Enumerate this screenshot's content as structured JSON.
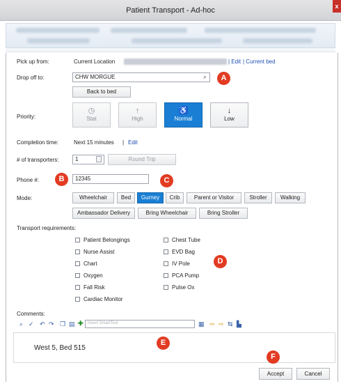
{
  "window": {
    "title": "Patient Transport - Ad-hoc",
    "close_glyph": "x"
  },
  "pickup": {
    "label": "Pick up from:",
    "value": "Current Location",
    "edit_link": "| Edit",
    "current_bed_link": "| Current bed"
  },
  "dropoff": {
    "label": "Drop off to:",
    "value": "CHW MORGUE",
    "back_to_bed": "Back to bed"
  },
  "priority": {
    "label": "Priority:",
    "options": [
      {
        "label": "Stat",
        "icon": "clock-icon",
        "glyph": "◷"
      },
      {
        "label": "High",
        "icon": "arrow-up-icon",
        "glyph": "↑"
      },
      {
        "label": "Normal",
        "icon": "accessibility-icon",
        "glyph": "♿"
      },
      {
        "label": "Low",
        "icon": "arrow-down-icon",
        "glyph": "↓"
      }
    ],
    "selected": "Normal"
  },
  "completion": {
    "label": "Completion time:",
    "value": "Next 15 minutes",
    "sep": "|",
    "edit_link": "Edit"
  },
  "transporters": {
    "label": "# of transporters:",
    "value": "1",
    "round_trip": "Round Trip"
  },
  "phone": {
    "label": "Phone #:",
    "value": "12345"
  },
  "mode": {
    "label": "Mode:",
    "row1": [
      "Wheelchair",
      "Bed",
      "Gurney",
      "Crib",
      "Parent or Visitor",
      "Stroller",
      "Walking"
    ],
    "row2": [
      "Ambassador Delivery",
      "Bring Wheelchair",
      "Bring Stroller"
    ],
    "selected": "Gurney"
  },
  "requirements": {
    "label": "Transport requirements:",
    "col1": [
      "Patient Belongings",
      "Nurse Assist",
      "Chart",
      "Oxygen",
      "Fall Risk",
      "Cardiac Monitor"
    ],
    "col2": [
      "Chest Tube",
      "EVD Bag",
      "IV Pole",
      "PCA Pump",
      "Pulse Ox"
    ]
  },
  "comments": {
    "label": "Comments:",
    "smarttext_placeholder": "Insert SmartText",
    "text": "West 5, Bed 515"
  },
  "footer": {
    "accept": "Accept",
    "cancel": "Cancel"
  },
  "markers": {
    "a": "A",
    "b": "B",
    "c": "C",
    "d": "D",
    "e": "E",
    "f": "F"
  },
  "colors": {
    "accent": "#1a7fd4",
    "marker": "#e23b22",
    "link": "#1f4fb4"
  }
}
